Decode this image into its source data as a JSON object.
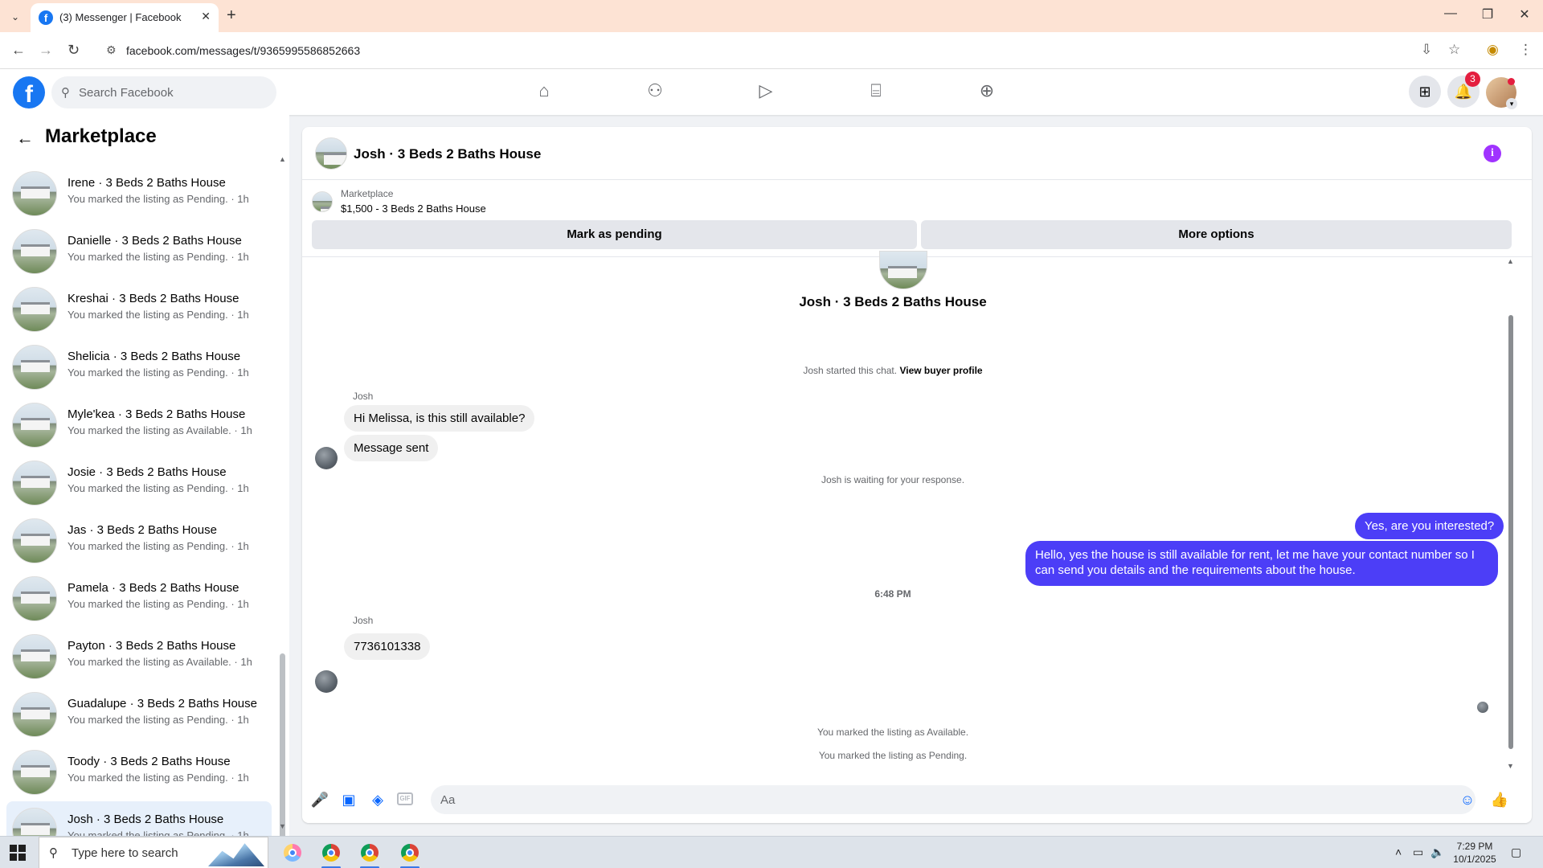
{
  "browser": {
    "tab_title": "(3) Messenger | Facebook",
    "tab_favicon": "f",
    "new_tab": "+",
    "url": "facebook.com/messages/t/9365995586852663",
    "window_controls": [
      "—",
      "❐",
      "✕"
    ]
  },
  "header": {
    "logo": "f",
    "search_placeholder": "Search Facebook",
    "nav_icons": [
      "home-icon",
      "friends-icon",
      "video-icon",
      "marketplace-icon",
      "gaming-icon"
    ],
    "notification_count": "3",
    "accent": "#1877f2"
  },
  "sidebar": {
    "title": "Marketplace",
    "conversations": [
      {
        "name": "Irene · 3 Beds 2 Baths House",
        "sub": "You marked the listing as Pending. · 1h"
      },
      {
        "name": "Danielle · 3 Beds 2 Baths House",
        "sub": "You marked the listing as Pending. · 1h"
      },
      {
        "name": "Kreshai · 3 Beds 2 Baths House",
        "sub": "You marked the listing as Pending. · 1h"
      },
      {
        "name": "Shelicia · 3 Beds 2 Baths House",
        "sub": "You marked the listing as Pending. · 1h"
      },
      {
        "name": "Myle'kea · 3 Beds 2 Baths House",
        "sub": "You marked the listing as Available. · 1h"
      },
      {
        "name": "Josie · 3 Beds 2 Baths House",
        "sub": "You marked the listing as Pending. · 1h"
      },
      {
        "name": "Jas · 3 Beds 2 Baths House",
        "sub": "You marked the listing as Pending. · 1h"
      },
      {
        "name": "Pamela · 3 Beds 2 Baths House",
        "sub": "You marked the listing as Pending. · 1h"
      },
      {
        "name": "Payton · 3 Beds 2 Baths House",
        "sub": "You marked the listing as Available. · 1h"
      },
      {
        "name": "Guadalupe · 3 Beds 2 Baths House",
        "sub": "You marked the listing as Pending. · 1h"
      },
      {
        "name": "Toody · 3 Beds 2 Baths House",
        "sub": "You marked the listing as Pending. · 1h"
      },
      {
        "name": "Josh · 3 Beds 2 Baths House",
        "sub": "You marked the listing as Pending. · 1h"
      }
    ]
  },
  "chat": {
    "title": "Josh · 3 Beds 2 Baths House",
    "listing_label": "Marketplace",
    "listing_price": "$1,500 - 3 Beds 2 Baths House",
    "mark_pending": "Mark as pending",
    "more_options": "More options",
    "center_name": "Josh · 3 Beds 2 Baths House",
    "started_text": "Josh started this chat.",
    "view_profile": "View buyer profile",
    "sender_1": "Josh",
    "msg_1": "Hi Melissa, is this still available?",
    "msg_2": "Message sent",
    "waiting": "Josh is waiting for your response.",
    "out_1": "Yes, are you interested?",
    "out_2": "Hello, yes the house is still available for rent, let me have your contact number so I can send you details and the requirements about the house.",
    "time": "6:48 PM",
    "sender_2": "Josh",
    "msg_3": "7736101338",
    "status_1": "You marked the listing as Available.",
    "status_2": "You marked the listing as Pending.",
    "composer_placeholder": "Aa",
    "outgoing_color": "#4c3ef7"
  },
  "taskbar": {
    "search_text": "Type here to search",
    "time": "7:29 PM",
    "date": "10/1/2025"
  }
}
